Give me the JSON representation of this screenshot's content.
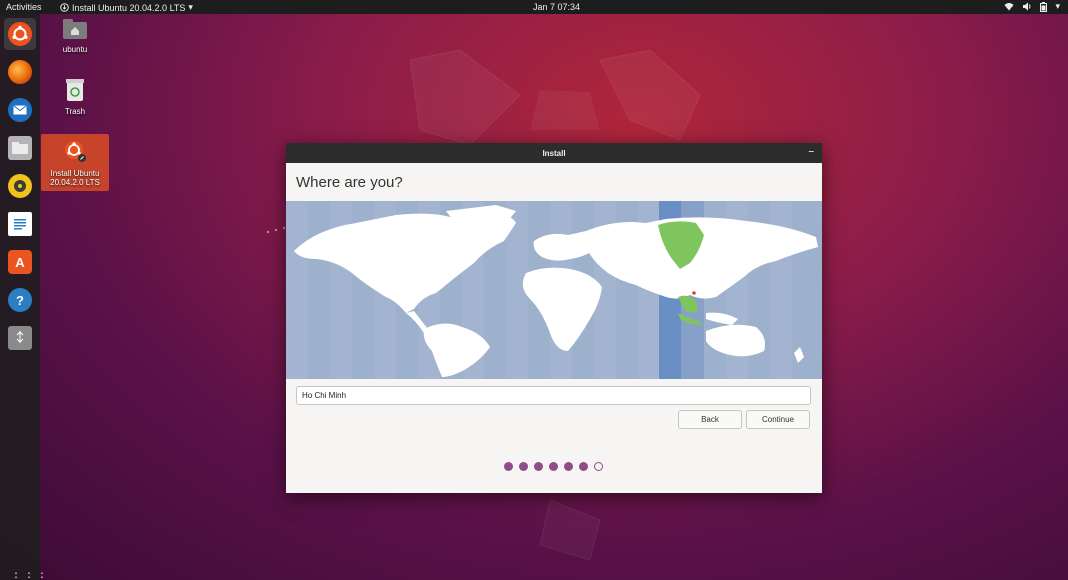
{
  "topbar": {
    "activities": "Activities",
    "app_menu": "Install Ubuntu 20.04.2.0 LTS",
    "clock": "Jan 7  07:34"
  },
  "dock": {
    "items": [
      {
        "name": "ubuntu-installer",
        "glyph": "◎",
        "color": "#e95420"
      },
      {
        "name": "firefox",
        "glyph": "◉",
        "color": "#e66000"
      },
      {
        "name": "thunderbird",
        "glyph": "✉",
        "color": "#1f6fc5"
      },
      {
        "name": "files",
        "glyph": "▭",
        "color": "#9a9a9a"
      },
      {
        "name": "rhythmbox",
        "glyph": "◉",
        "color": "#f0c419"
      },
      {
        "name": "libreoffice-writer",
        "glyph": "≡",
        "color": "#2a7ec4"
      },
      {
        "name": "ubuntu-software",
        "glyph": "A",
        "color": "#e95420"
      },
      {
        "name": "help",
        "glyph": "?",
        "color": "#2a7ec4"
      },
      {
        "name": "usb-drive",
        "glyph": "⇣",
        "color": "#8a8a8a"
      }
    ],
    "show_apps": "⋮⋮⋮"
  },
  "desktop": {
    "icons": [
      {
        "label": "ubuntu"
      },
      {
        "label": "Trash"
      },
      {
        "label": "Install Ubuntu 20.04.2.0 LTS"
      }
    ]
  },
  "window": {
    "title": "Install",
    "minimize": "–",
    "heading": "Where are you?",
    "selected_timezone_highlight": "#6a8fc4",
    "selected_region_color": "#7fc55e",
    "city_value": "Ho Chi Minh",
    "back_label": "Back",
    "continue_label": "Continue",
    "progress": {
      "total_steps": 7,
      "completed_steps": 6
    }
  },
  "colors": {
    "accent": "#e95420",
    "progress_dot": "#8e4c8a",
    "ocean": "#9db0cc",
    "land": "#ffffff"
  }
}
